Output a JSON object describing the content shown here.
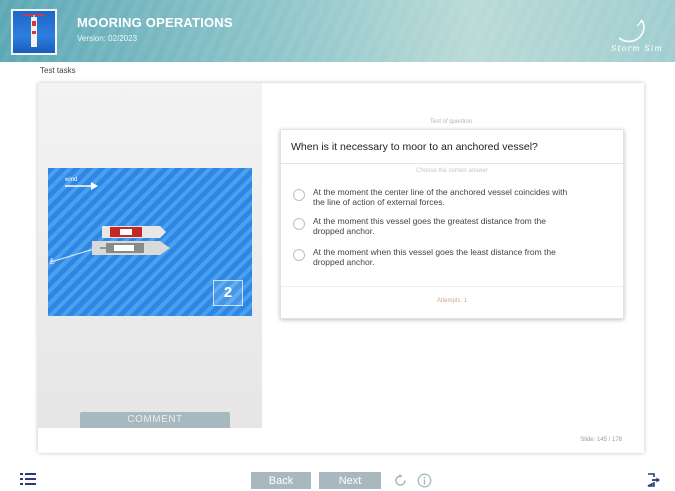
{
  "header": {
    "title": "MOORING OPERATIONS",
    "version": "Version: 02/2023",
    "brand": "Storm Sim",
    "logo_icon": "ship-logo-icon",
    "accent_color": "#5aa7b5"
  },
  "breadcrumb": "Test tasks",
  "left_panel": {
    "wind_label": "wind",
    "image_number": "2",
    "comment_label": "COMMENT"
  },
  "question": {
    "meta": "Test of question",
    "text": "When is it necessary to moor to an anchored vessel?",
    "instruction": "Choose the correct answer",
    "options": [
      {
        "line1": "At the moment the center line of the anchored vessel coincides with",
        "line2": "the line of action of external forces."
      },
      {
        "line1": "At the moment this vessel goes the greatest distance from the",
        "line2": "dropped anchor."
      },
      {
        "line1": "At the moment when this vessel goes the least distance from the",
        "line2": "dropped anchor."
      }
    ],
    "attempts": "Attempts: 1"
  },
  "slide_counter": "Slide: 145 / 178",
  "footer": {
    "back_label": "Back",
    "next_label": "Next",
    "icons": [
      "menu-icon",
      "reload-icon",
      "info-icon",
      "exit-icon"
    ]
  }
}
